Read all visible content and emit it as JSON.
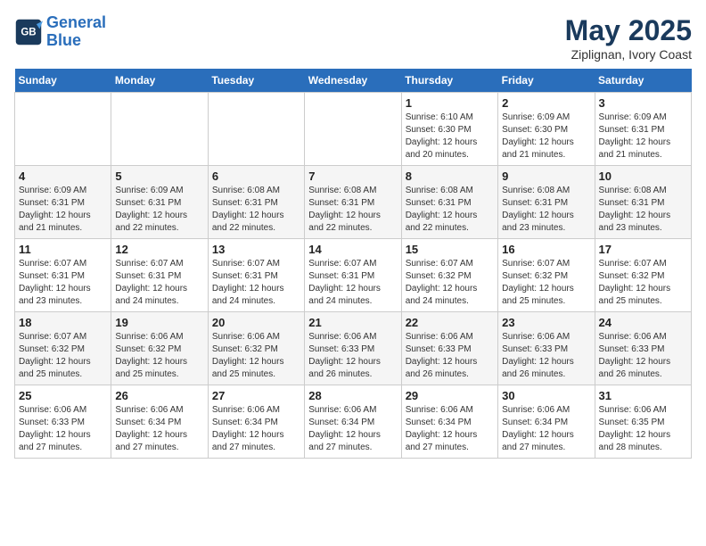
{
  "logo": {
    "line1": "General",
    "line2": "Blue"
  },
  "title": "May 2025",
  "subtitle": "Ziplignan, Ivory Coast",
  "weekdays": [
    "Sunday",
    "Monday",
    "Tuesday",
    "Wednesday",
    "Thursday",
    "Friday",
    "Saturday"
  ],
  "weeks": [
    [
      {
        "day": "",
        "info": ""
      },
      {
        "day": "",
        "info": ""
      },
      {
        "day": "",
        "info": ""
      },
      {
        "day": "",
        "info": ""
      },
      {
        "day": "1",
        "info": "Sunrise: 6:10 AM\nSunset: 6:30 PM\nDaylight: 12 hours\nand 20 minutes."
      },
      {
        "day": "2",
        "info": "Sunrise: 6:09 AM\nSunset: 6:30 PM\nDaylight: 12 hours\nand 21 minutes."
      },
      {
        "day": "3",
        "info": "Sunrise: 6:09 AM\nSunset: 6:31 PM\nDaylight: 12 hours\nand 21 minutes."
      }
    ],
    [
      {
        "day": "4",
        "info": "Sunrise: 6:09 AM\nSunset: 6:31 PM\nDaylight: 12 hours\nand 21 minutes."
      },
      {
        "day": "5",
        "info": "Sunrise: 6:09 AM\nSunset: 6:31 PM\nDaylight: 12 hours\nand 22 minutes."
      },
      {
        "day": "6",
        "info": "Sunrise: 6:08 AM\nSunset: 6:31 PM\nDaylight: 12 hours\nand 22 minutes."
      },
      {
        "day": "7",
        "info": "Sunrise: 6:08 AM\nSunset: 6:31 PM\nDaylight: 12 hours\nand 22 minutes."
      },
      {
        "day": "8",
        "info": "Sunrise: 6:08 AM\nSunset: 6:31 PM\nDaylight: 12 hours\nand 22 minutes."
      },
      {
        "day": "9",
        "info": "Sunrise: 6:08 AM\nSunset: 6:31 PM\nDaylight: 12 hours\nand 23 minutes."
      },
      {
        "day": "10",
        "info": "Sunrise: 6:08 AM\nSunset: 6:31 PM\nDaylight: 12 hours\nand 23 minutes."
      }
    ],
    [
      {
        "day": "11",
        "info": "Sunrise: 6:07 AM\nSunset: 6:31 PM\nDaylight: 12 hours\nand 23 minutes."
      },
      {
        "day": "12",
        "info": "Sunrise: 6:07 AM\nSunset: 6:31 PM\nDaylight: 12 hours\nand 24 minutes."
      },
      {
        "day": "13",
        "info": "Sunrise: 6:07 AM\nSunset: 6:31 PM\nDaylight: 12 hours\nand 24 minutes."
      },
      {
        "day": "14",
        "info": "Sunrise: 6:07 AM\nSunset: 6:31 PM\nDaylight: 12 hours\nand 24 minutes."
      },
      {
        "day": "15",
        "info": "Sunrise: 6:07 AM\nSunset: 6:32 PM\nDaylight: 12 hours\nand 24 minutes."
      },
      {
        "day": "16",
        "info": "Sunrise: 6:07 AM\nSunset: 6:32 PM\nDaylight: 12 hours\nand 25 minutes."
      },
      {
        "day": "17",
        "info": "Sunrise: 6:07 AM\nSunset: 6:32 PM\nDaylight: 12 hours\nand 25 minutes."
      }
    ],
    [
      {
        "day": "18",
        "info": "Sunrise: 6:07 AM\nSunset: 6:32 PM\nDaylight: 12 hours\nand 25 minutes."
      },
      {
        "day": "19",
        "info": "Sunrise: 6:06 AM\nSunset: 6:32 PM\nDaylight: 12 hours\nand 25 minutes."
      },
      {
        "day": "20",
        "info": "Sunrise: 6:06 AM\nSunset: 6:32 PM\nDaylight: 12 hours\nand 25 minutes."
      },
      {
        "day": "21",
        "info": "Sunrise: 6:06 AM\nSunset: 6:33 PM\nDaylight: 12 hours\nand 26 minutes."
      },
      {
        "day": "22",
        "info": "Sunrise: 6:06 AM\nSunset: 6:33 PM\nDaylight: 12 hours\nand 26 minutes."
      },
      {
        "day": "23",
        "info": "Sunrise: 6:06 AM\nSunset: 6:33 PM\nDaylight: 12 hours\nand 26 minutes."
      },
      {
        "day": "24",
        "info": "Sunrise: 6:06 AM\nSunset: 6:33 PM\nDaylight: 12 hours\nand 26 minutes."
      }
    ],
    [
      {
        "day": "25",
        "info": "Sunrise: 6:06 AM\nSunset: 6:33 PM\nDaylight: 12 hours\nand 27 minutes."
      },
      {
        "day": "26",
        "info": "Sunrise: 6:06 AM\nSunset: 6:34 PM\nDaylight: 12 hours\nand 27 minutes."
      },
      {
        "day": "27",
        "info": "Sunrise: 6:06 AM\nSunset: 6:34 PM\nDaylight: 12 hours\nand 27 minutes."
      },
      {
        "day": "28",
        "info": "Sunrise: 6:06 AM\nSunset: 6:34 PM\nDaylight: 12 hours\nand 27 minutes."
      },
      {
        "day": "29",
        "info": "Sunrise: 6:06 AM\nSunset: 6:34 PM\nDaylight: 12 hours\nand 27 minutes."
      },
      {
        "day": "30",
        "info": "Sunrise: 6:06 AM\nSunset: 6:34 PM\nDaylight: 12 hours\nand 27 minutes."
      },
      {
        "day": "31",
        "info": "Sunrise: 6:06 AM\nSunset: 6:35 PM\nDaylight: 12 hours\nand 28 minutes."
      }
    ]
  ]
}
